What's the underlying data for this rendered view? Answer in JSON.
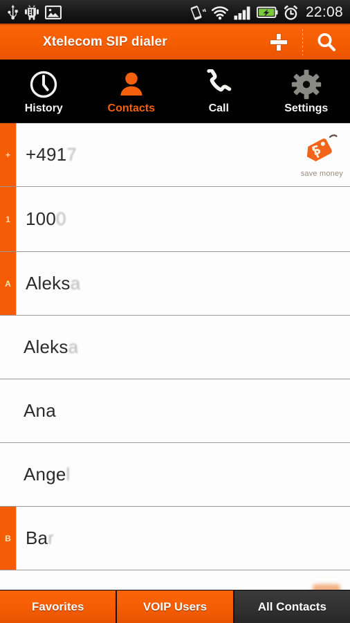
{
  "statusbar": {
    "time": "22:08",
    "icons": [
      "usb-icon",
      "android-debug-icon",
      "screenshot-image-icon",
      "vibrate-icon",
      "wifi-icon",
      "signal-icon",
      "battery-charging-icon",
      "alarm-icon"
    ]
  },
  "titlebar": {
    "title": "Xtelecom SIP dialer",
    "add_label": "+",
    "add_icon": "plus-icon",
    "search_icon": "search-icon"
  },
  "tabs": [
    {
      "label": "History",
      "icon": "clock-icon",
      "active": false
    },
    {
      "label": "Contacts",
      "icon": "person-icon",
      "active": true
    },
    {
      "label": "Call",
      "icon": "phone-icon",
      "active": false
    },
    {
      "label": "Settings",
      "icon": "gear-icon",
      "active": false
    }
  ],
  "contacts": [
    {
      "index": "+",
      "name_visible": "+491",
      "name_faded": "7",
      "name_ghost": "",
      "badge": "save money",
      "badge_icon": "price-tag-icon"
    },
    {
      "index": "1",
      "name_visible": "100",
      "name_faded": "0",
      "name_ghost": "",
      "badge": "",
      "badge_icon": ""
    },
    {
      "index": "A",
      "name_visible": "Aleks",
      "name_faded": "a",
      "name_ghost": "",
      "badge": "",
      "badge_icon": ""
    },
    {
      "index": "",
      "name_visible": "Aleks",
      "name_faded": "a",
      "name_ghost": "",
      "badge": "",
      "badge_icon": ""
    },
    {
      "index": "",
      "name_visible": "Ana",
      "name_faded": "",
      "name_ghost": "",
      "badge": "",
      "badge_icon": ""
    },
    {
      "index": "",
      "name_visible": "Ange",
      "name_faded": "l",
      "name_ghost": "",
      "badge": "",
      "badge_icon": ""
    },
    {
      "index": "B",
      "name_visible": "Ba",
      "name_faded": "r",
      "name_ghost": "",
      "badge": "",
      "badge_icon": ""
    }
  ],
  "bottombar": [
    {
      "label": "Favorites",
      "selected": false
    },
    {
      "label": "VOIP Users",
      "selected": false
    },
    {
      "label": "All Contacts",
      "selected": true
    }
  ],
  "colors": {
    "accent_orange": "#f45d06",
    "titlebar_orange": "#f55d02",
    "tabbar_black": "#000000",
    "selected_tab_dark": "#303030",
    "index_letter": "#ffe2b0",
    "list_background": "#fdfdfd"
  }
}
